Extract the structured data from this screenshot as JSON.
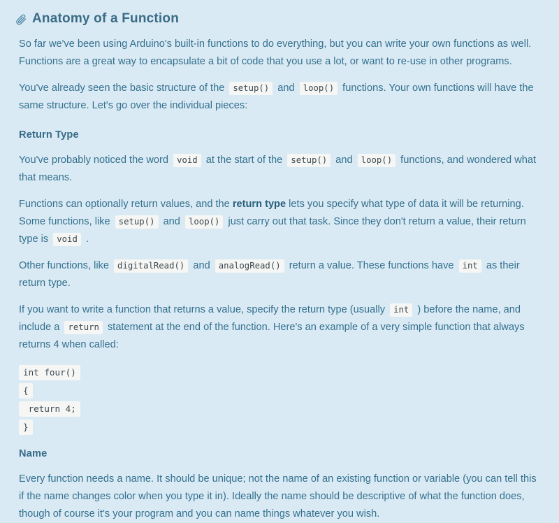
{
  "page": {
    "background_color": "#daeaf4",
    "text_color": "#33708e",
    "heading_color": "#3a6b86",
    "code_background_color": "#f6f6f4",
    "code_text_color": "#3c4a52"
  },
  "title": {
    "text": "Anatomy of a Function",
    "icon": "paperclip-icon"
  },
  "paragraphs": {
    "intro": {
      "line1": "So far we've been using Arduino's built-in functions to do everything, but you can write your own functions as well.",
      "line2": "Functions are a great way to encapsulate a bit of code that you use a lot, or want to re-use in other programs.",
      "full": "So far we've been using Arduino's built-in functions to do everything, but you can write your own functions as well. Functions are a great way to encapsulate a bit of code that you use a lot, or want to re-use in other programs."
    },
    "structure": {
      "part1": "You've already seen the basic structure of the",
      "code1": "setup()",
      "part2": "and",
      "code2": "loop()",
      "part3": "functions. Your own functions will have the same structure. Let's go over the individual pieces:"
    },
    "void_intro": {
      "part1": "You've probably noticed the word",
      "code1": "void",
      "part2": "at the start of the",
      "code2": "setup()",
      "part3": "and",
      "code3": "loop()",
      "part4": "functions, and wondered what that means."
    },
    "return_values": {
      "part1": "Functions can optionally return values, and the",
      "bold1": "return type",
      "part2": "lets you specify what type of data it will be returning. Some functions, like",
      "code1": "setup()",
      "part3": "and",
      "code2": "loop()",
      "part4": "just carry out that task. Since they don't return a value, their return type is",
      "code3": "void",
      "part5": "."
    },
    "other_functions": {
      "part1": "Other functions, like",
      "code1": "digitalRead()",
      "part2": "and",
      "code2": "analogRead()",
      "part3": "return a value. These functions have",
      "code3": "int",
      "part4": "as their return type."
    },
    "write_function": {
      "part1": "If you want to write a function that returns a value, specify the return type (usually",
      "code1": "int",
      "part2": ") before the name, and include a",
      "code2": "return",
      "part3": "statement at the end of the function. Here's an example of a very simple function that always returns 4 when called:"
    },
    "name_body": {
      "full": "Every function needs a name. It should be unique; not the name of an existing function or variable (you can tell this if the name changes color when you type it in). Ideally the name should be descriptive of what the function does, though of course it's your program and you can name things whatever you wish."
    }
  },
  "sections": {
    "return_type_heading": "Return Type",
    "name_heading": "Name"
  },
  "code_block": {
    "language": "c",
    "lines": [
      "int four()",
      "{",
      " return 4;",
      "}"
    ]
  }
}
